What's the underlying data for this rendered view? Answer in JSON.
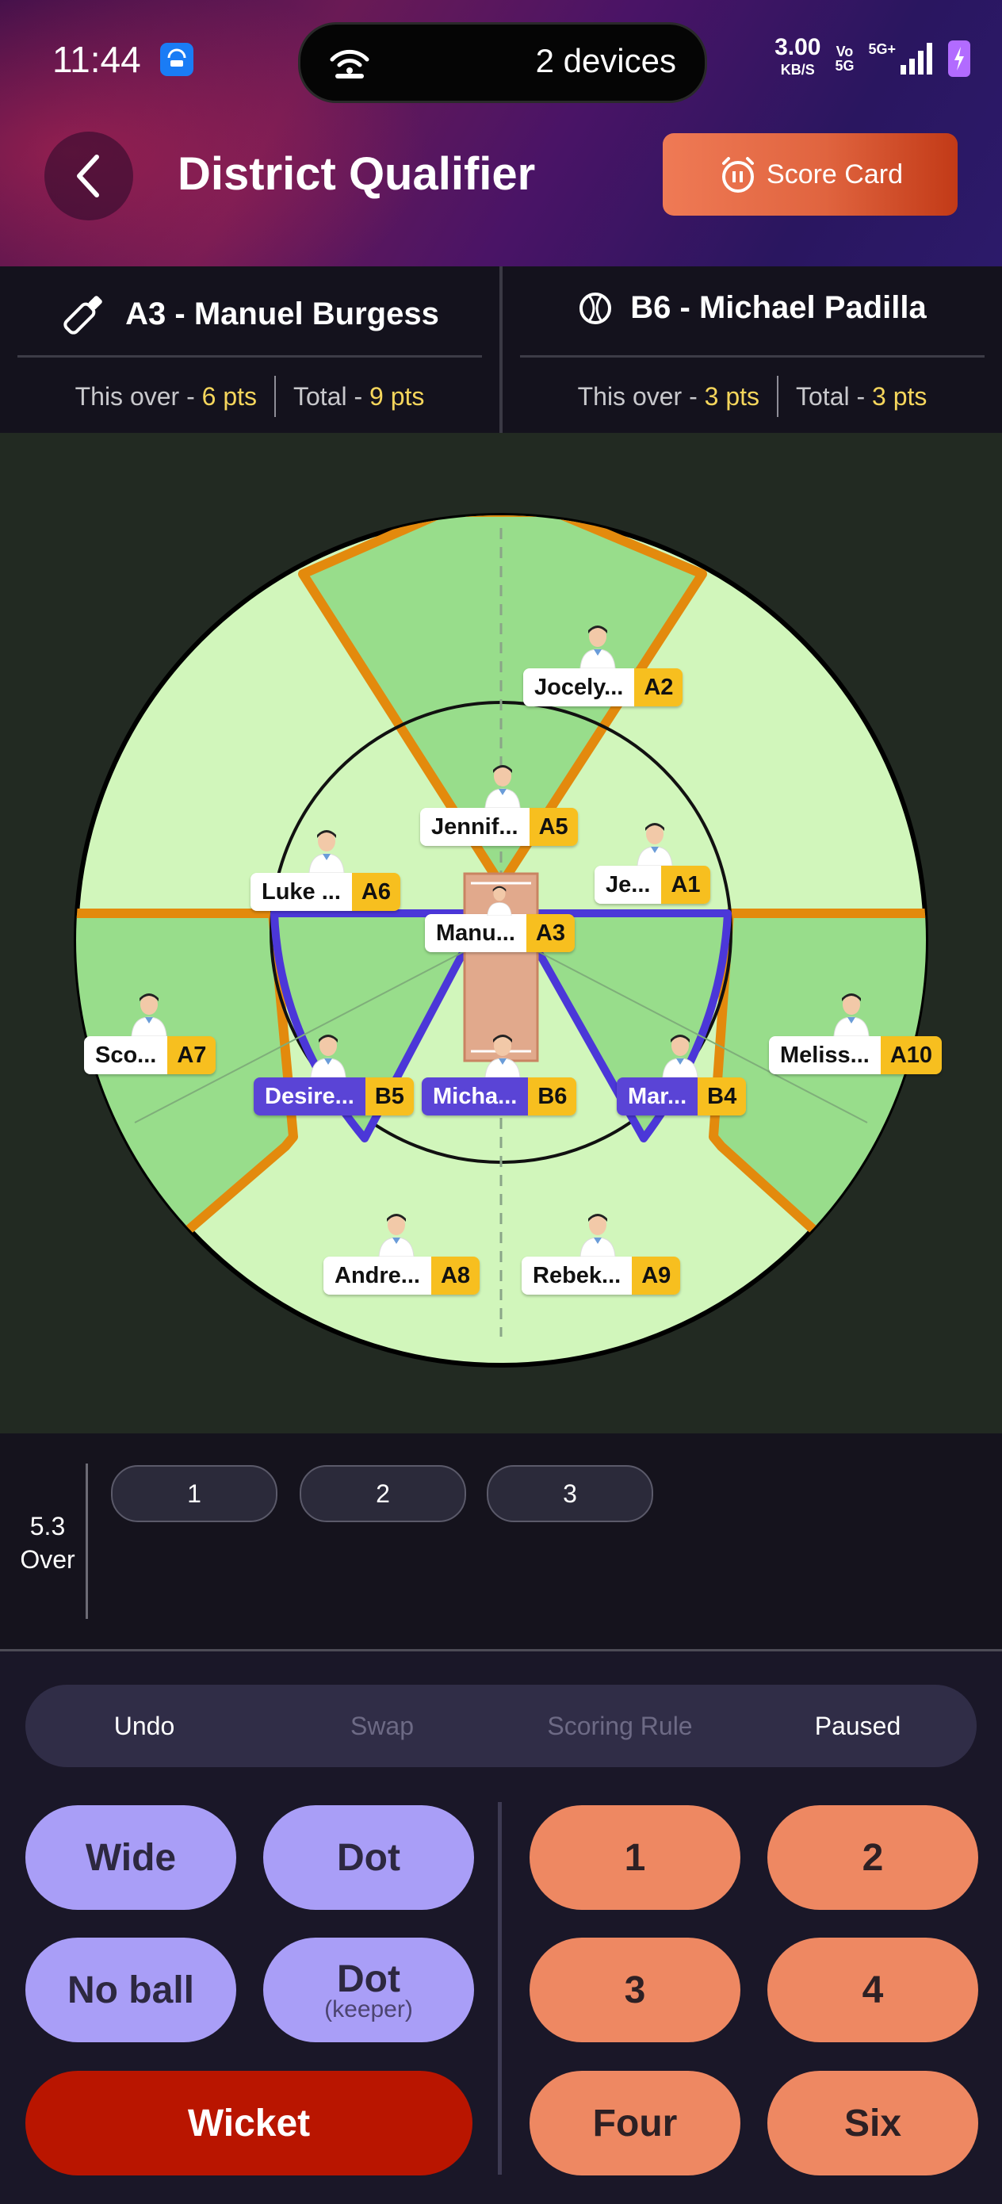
{
  "status_bar": {
    "time": "11:44",
    "island_text": "2 devices",
    "speed_value": "3.00",
    "speed_unit": "KB/S",
    "volte_top": "Vo",
    "volte_bottom": "5G",
    "network": "5G+"
  },
  "header": {
    "title": "District Qualifier",
    "scorecard_label": "Score Card"
  },
  "batter": {
    "name": "A3 - Manuel Burgess",
    "this_over_label": "This over - ",
    "this_over_value": "6 pts",
    "total_label": "Total - ",
    "total_value": "9 pts"
  },
  "bowler": {
    "name": "B6 - Michael Padilla",
    "this_over_label": "This over - ",
    "this_over_value": "3 pts",
    "total_label": "Total - ",
    "total_value": "3 pts"
  },
  "fielders": [
    {
      "name": "Jocely...",
      "code": "A2",
      "team": "A"
    },
    {
      "name": "Jennif...",
      "code": "A5",
      "team": "A"
    },
    {
      "name": "Luke ...",
      "code": "A6",
      "team": "A"
    },
    {
      "name": "Je...",
      "code": "A1",
      "team": "A"
    },
    {
      "name": "Manu...",
      "code": "A3",
      "team": "A"
    },
    {
      "name": "Sco...",
      "code": "A7",
      "team": "A"
    },
    {
      "name": "Desire...",
      "code": "B5",
      "team": "B"
    },
    {
      "name": "Micha...",
      "code": "B6",
      "team": "B"
    },
    {
      "name": "Mar...",
      "code": "B4",
      "team": "B"
    },
    {
      "name": "Meliss...",
      "code": "A10",
      "team": "A"
    },
    {
      "name": "Andre...",
      "code": "A8",
      "team": "A"
    },
    {
      "name": "Rebek...",
      "code": "A9",
      "team": "A"
    }
  ],
  "over": {
    "number": "5.3",
    "label": "Over",
    "balls": [
      "1",
      "2",
      "3"
    ]
  },
  "tabs": [
    {
      "label": "Undo",
      "enabled": true
    },
    {
      "label": "Swap",
      "enabled": false
    },
    {
      "label": "Scoring Rule",
      "enabled": false
    },
    {
      "label": "Paused",
      "enabled": true
    }
  ],
  "buttons": {
    "wide": "Wide",
    "dot": "Dot",
    "no_ball": "No ball",
    "dot_keeper": "Dot",
    "dot_keeper_sub": "(keeper)",
    "wicket": "Wicket",
    "run1": "1",
    "run2": "2",
    "run3": "3",
    "run4": "4",
    "four": "Four",
    "six": "Six"
  },
  "colors": {
    "team_a_tag": "#f7bf1f",
    "team_b_tag": "#5a44d6",
    "accent_orange": "#ee8862",
    "accent_purple": "#a99ef7",
    "wicket_red": "#b91500",
    "highlight_yellow": "#f6d65c"
  }
}
